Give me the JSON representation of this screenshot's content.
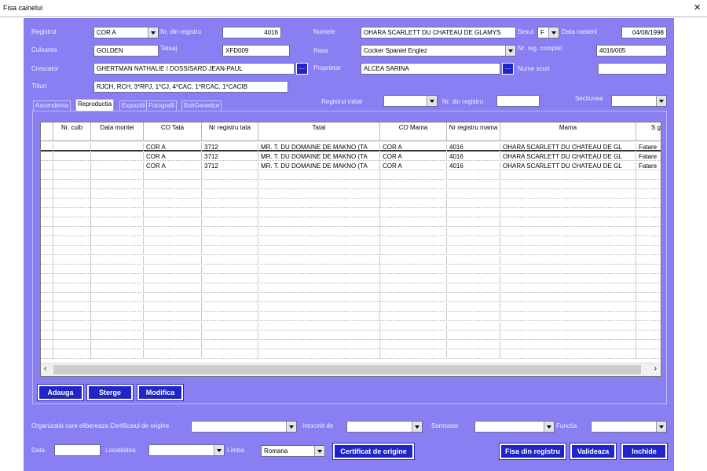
{
  "window": {
    "title": "Fisa cainelui",
    "close": "×"
  },
  "labels": {
    "registrul": "Registrul",
    "nr_din_registru": "Nr. din registru",
    "numele": "Numele",
    "sexul": "Sexul",
    "data_nasterii": "Data nasterii",
    "culoarea": "Culoarea",
    "tatuaj": "Tatuaj",
    "rasa": "Rasa",
    "nr_reg_complet": "Nr. reg. complet",
    "crescator": "Crescator",
    "proprietar": "Proprietar",
    "nume_scurt": "Nume scurt",
    "titluri": "Titluri",
    "registrul_initial": "Registrul initial",
    "nr_din_registru2": "Nr. din registru",
    "sectiunea": "Sectiunea",
    "organizatia": "Organizatia care elibereaza Certificatul de origine",
    "intocmit_de": "Intocmit de",
    "semnatar": "Semnatar",
    "functia": "Functia",
    "data": "Data",
    "localitatea": "Localitatea",
    "limba": "Limba"
  },
  "fields": {
    "registrul": "COR A",
    "nr_din_registru": "4016",
    "numele": "OHARA SCARLETT DU CHATEAU DE GLAMYS",
    "sexul": "F",
    "data_nasterii": "04/08/1998",
    "culoarea": "GOLDEN",
    "tatuaj": "XFD009",
    "rasa": "Cocker Spaniel Englez",
    "nr_reg_complet": "4016/005",
    "crescator": "GHERTMAN NATHALIE / DOSSISARD JEAN-PAUL",
    "proprietar": "ALCEA SARINA",
    "nume_scurt": "",
    "titluri": "RJCH, RCH, 3*RPJ, 1*CJ, 4*CAC, 1*RCAC, 1*CACIB",
    "registrul_initial": "",
    "nr_din_registru2": "",
    "sectiunea": "",
    "organizatia": "",
    "intocmit_de": "",
    "semnatar": "",
    "functia": "",
    "data": "",
    "localitatea": "",
    "limba": "Romana"
  },
  "tabs": [
    "Ascendenta",
    "Reproductia",
    "Expozitii",
    "Fotografii",
    "BoliGenetice"
  ],
  "grid": {
    "columns": [
      "Nr. cuib",
      "Data montei",
      "CO Tata",
      "Nr registru tata",
      "Tatal",
      "CO Mama",
      "Nr registru mama",
      "Mama",
      "S g"
    ],
    "rows": [
      [
        "",
        "",
        "COR A",
        "3712",
        "MR. T. DU DOMAINE DE MAKNO (TA",
        "COR A",
        "4016",
        "OHARA SCARLETT DU CHATEAU DE GL",
        "Fatare"
      ],
      [
        "",
        "",
        "COR A",
        "3712",
        "MR. T. DU DOMAINE DE MAKNO (TA",
        "COR A",
        "4016",
        "OHARA SCARLETT DU CHATEAU DE GL",
        "Fatare"
      ],
      [
        "",
        "",
        "COR A",
        "3712",
        "MR. T. DU DOMAINE DE MAKNO (TA",
        "COR A",
        "4016",
        "OHARA SCARLETT DU CHATEAU DE GL",
        "Fatare"
      ]
    ]
  },
  "buttons": {
    "adauga": "Adauga",
    "sterge": "Sterge",
    "modifica": "Modifica",
    "certificat": "Certificat de origine",
    "fisa": "Fisa din registru",
    "valideaza": "Valideaza",
    "inchide": "Inchide"
  },
  "colors": {
    "background": "#8a7ff2",
    "button": "#1f25c8"
  }
}
